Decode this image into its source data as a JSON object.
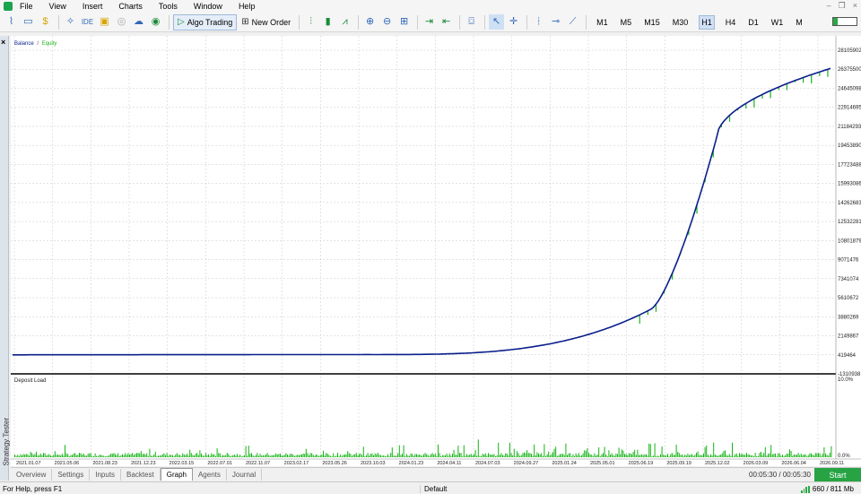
{
  "menu": [
    "File",
    "View",
    "Insert",
    "Charts",
    "Tools",
    "Window",
    "Help"
  ],
  "toolbar": {
    "algo_trading_label": "Algo Trading",
    "new_order_label": "New Order",
    "timeframes": [
      "M1",
      "M5",
      "M15",
      "M30",
      "H1",
      "H4",
      "D1",
      "W1",
      "M"
    ],
    "active_timeframe": "H1"
  },
  "side_panel": {
    "label": "Strategy Tester",
    "close_glyph": "×"
  },
  "colors": {
    "balance": "#0a1f8c",
    "equity": "#1db11d",
    "load": "#16b316",
    "grid": "#c8c8c8",
    "start": "#27a344"
  },
  "chart_data": [
    {
      "type": "line",
      "legend": {
        "balance": "Balance",
        "separator": "/",
        "equity": "Equity"
      },
      "y_ticks": [
        "28105902",
        "26375500",
        "24645098",
        "22914695",
        "21184293",
        "19453890",
        "17723488",
        "15993086",
        "14262683",
        "12532281",
        "10801879",
        "9071476",
        "7341074",
        "5610672",
        "3880269",
        "2149867",
        "419464",
        "-1310938"
      ],
      "ylim": [
        -1310938,
        28105902
      ],
      "x_ticks": [
        "2021.01.07",
        "2021.05.06",
        "2021.08.23",
        "2021.12.23",
        "2022.03.15",
        "2022.07.01",
        "2022.11.07",
        "2023.02.17",
        "2023.05.26",
        "2023.10.03",
        "2024.01.23",
        "2024.04.11",
        "2024.07.03",
        "2024.09.27",
        "2025.01.24",
        "2025.05.01",
        "2025.06.19",
        "2025.09.19",
        "2025.12.02",
        "2026.03.09",
        "2026.06.04",
        "2026.09.11"
      ],
      "series": [
        {
          "name": "Balance",
          "x": [
            0,
            5,
            10,
            15,
            18,
            20,
            21,
            22,
            23,
            24,
            25,
            25.5,
            26,
            26.6,
            27.2,
            27.8,
            28.4,
            29,
            29.3,
            29.5,
            29.8,
            30,
            30.5,
            31,
            31.5,
            32,
            32.5,
            33,
            33.5,
            34,
            34.5,
            35,
            35.5,
            36,
            36.5,
            37,
            37.3,
            37.6,
            37.9,
            38.2,
            38.5,
            38.8,
            39.1,
            39.4,
            39.7,
            40,
            40.3,
            40.6,
            40.9,
            41.2,
            41.5,
            41.8,
            42.1,
            42.4,
            42.7,
            43,
            43.3,
            43.6,
            43.9,
            44.2,
            44.5,
            44.8,
            45.1,
            45.4,
            45.7,
            46,
            46.3,
            46.6,
            46.9,
            47.2,
            47.5,
            47.8,
            48.1,
            48.4,
            48.7,
            49,
            49.3,
            49.6,
            49.9,
            50.2,
            50.5,
            50.8,
            51.1,
            51.4,
            51.7,
            52,
            52.3,
            52.6,
            52.9,
            53.2,
            53.5,
            53.8,
            54.1,
            54.4,
            54.7,
            55,
            55.3,
            55.6,
            55.9,
            56.2,
            56.5,
            56.8,
            57.1,
            57.4,
            57.7,
            58,
            58.3,
            58.6,
            58.9,
            59.2,
            59.5,
            59.8,
            60,
            60.3,
            60.6,
            60.9,
            61.2,
            61.5,
            61.8,
            62.1,
            62.4,
            62.7,
            63,
            63.5,
            64
          ],
          "values": [
            419464,
            419464,
            440000,
            430000,
            520000,
            500000,
            560000,
            600000,
            700000,
            820000,
            1000000,
            1100000,
            1250000,
            1500000,
            1850000,
            2300000,
            2900000,
            3500000,
            3900000,
            4300000,
            4700000,
            4900000,
            5500000,
            6400000,
            7300000,
            8400000,
            9600000,
            11000000,
            12800000,
            14800000,
            16800000,
            18300000,
            19500000,
            20300000,
            21000000,
            21400000,
            21700000,
            22000000,
            22200000,
            22400000,
            22600000,
            22800000,
            23000000,
            23100000,
            23300000,
            23500000,
            23700000,
            23900000,
            24100000,
            24300000,
            24500000,
            24650000,
            24800000,
            24950000,
            25100000,
            25250000,
            25400000,
            25550000,
            25700000,
            25850000,
            26000000,
            26150000,
            26300000,
            26400000,
            26500000,
            26600000,
            26700000,
            26800000,
            26900000,
            27000000,
            27100000,
            27200000,
            27300000,
            27400000,
            27500000,
            27600000,
            27700000,
            27800000,
            27900000,
            28000000,
            28050000,
            28100000,
            28105902,
            28105902,
            28105902,
            28105902,
            28105902,
            28105902,
            28105902,
            28105902,
            28105902,
            28105902,
            28105902,
            28105902,
            28105902,
            28105902,
            28105902,
            28105902,
            28105902,
            28105902,
            28105902,
            28105902,
            28105902,
            28105902,
            28105902,
            28105902,
            28105902,
            28105902,
            28105902,
            28105902,
            28105902,
            28105902,
            28105902,
            28105902,
            28105902,
            28105902,
            28105902,
            28105902,
            28105902,
            28105902,
            28105902,
            28105902,
            28105902,
            28105902,
            28105902
          ]
        }
      ]
    },
    {
      "type": "bar",
      "legend": "Deposit Load",
      "y_ticks": [
        "10.0%",
        "0.0%"
      ],
      "ylim": [
        0,
        10
      ]
    }
  ],
  "tabs": [
    "Overview",
    "Settings",
    "Inputs",
    "Backtest",
    "Graph",
    "Agents",
    "Journal"
  ],
  "active_tab": "Graph",
  "elapsed": "00:05:30 / 00:05:30",
  "start_label": "Start",
  "status": {
    "help": "For Help, press F1",
    "profile": "Default",
    "memory": "660 / 811 Mb"
  },
  "battery_level": 0.2
}
